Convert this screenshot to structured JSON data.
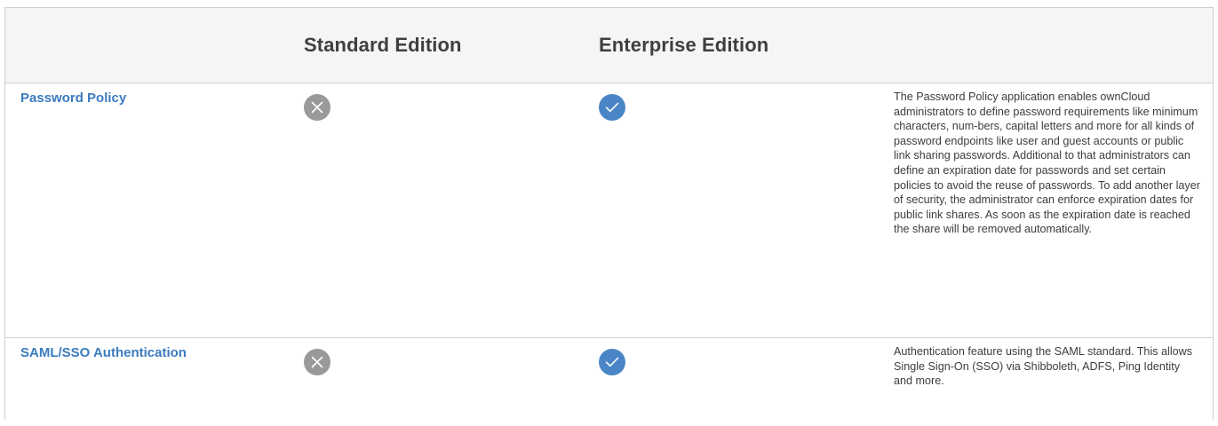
{
  "header": {
    "feature_col": "",
    "standard_col": "Standard Edition",
    "enterprise_col": "Enterprise Edition",
    "description_col": ""
  },
  "rows": [
    {
      "feature": "Password Policy",
      "standard": "not-included",
      "enterprise": "included",
      "standard_icon": "cross-circle-icon",
      "enterprise_icon": "check-circle-icon",
      "description": "The Password Policy application enables ownCloud administrators to define password requirements like minimum characters, num-bers, capital letters and more for all kinds of password endpoints like user and guest accounts or public link sharing passwords. Additional to that administrators can define an expiration date for passwords and set certain policies to avoid the reuse of passwords. To add another layer of security, the administrator can enforce expiration dates for public link shares. As soon as the expiration date is reached the share will be removed automatically."
    },
    {
      "feature": "SAML/SSO Authentication",
      "standard": "not-included",
      "enterprise": "included",
      "standard_icon": "cross-circle-icon",
      "enterprise_icon": "check-circle-icon",
      "description": "Authentication feature using the SAML standard. This allows Single Sign-On (SSO) via Shibboleth, ADFS, Ping Identity and more."
    }
  ],
  "colors": {
    "link": "#3a7bbf",
    "included": "#4a86c5",
    "not_included": "#999999",
    "header_bg": "#f5f5f5",
    "border": "#cfcfcf"
  }
}
